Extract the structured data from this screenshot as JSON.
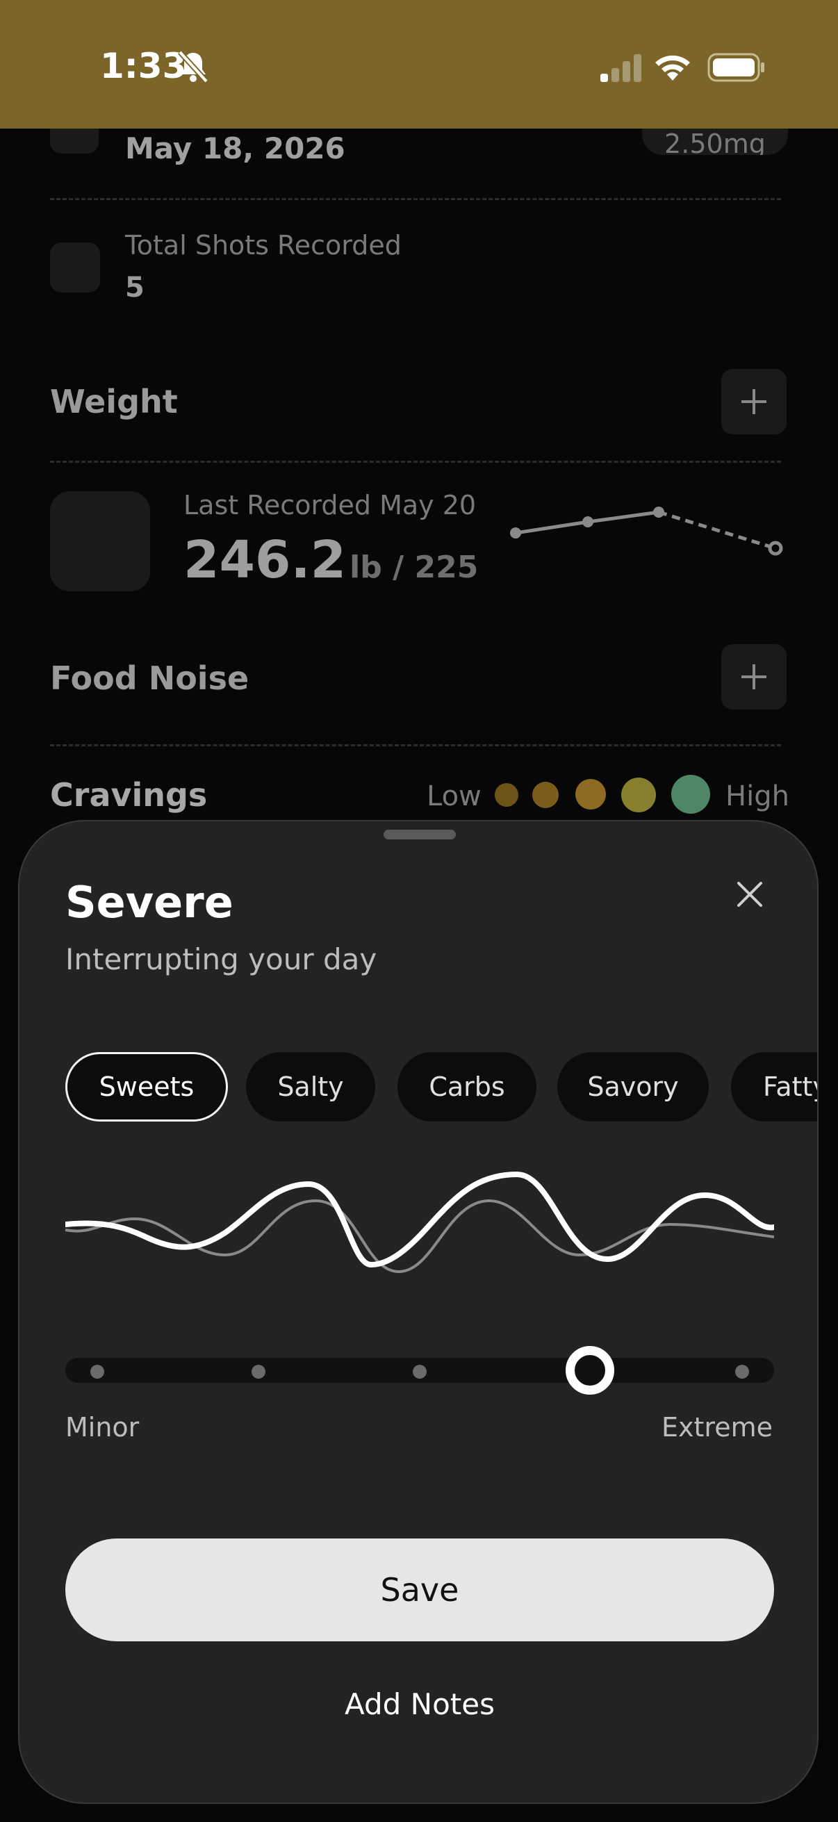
{
  "status_bar": {
    "time": "1:33"
  },
  "background": {
    "last_shot_date": "May 18, 2026",
    "dose": "2.50mg",
    "total_shots_label": "Total Shots Recorded",
    "total_shots_value": "5",
    "weight_label": "Weight",
    "weight_last_recorded": "Last Recorded May 20",
    "weight_value": "246.2",
    "weight_goal": "lb / 225",
    "food_noise_label": "Food Noise",
    "cravings_label": "Cravings",
    "cravings_low": "Low",
    "cravings_high": "High",
    "craving_colors": [
      "#8b6a1a",
      "#9a6e1e",
      "#b07e26",
      "#a7a03a",
      "#5fa27c"
    ]
  },
  "sheet": {
    "title": "Severe",
    "subtitle": "Interrupting your day",
    "chips": [
      "Sweets",
      "Salty",
      "Carbs",
      "Savory",
      "Fatty"
    ],
    "selected_chip": "Sweets",
    "scale_min_label": "Minor",
    "scale_max_label": "Extreme",
    "level": 4,
    "level_count": 5,
    "save_label": "Save",
    "notes_label": "Add Notes"
  }
}
